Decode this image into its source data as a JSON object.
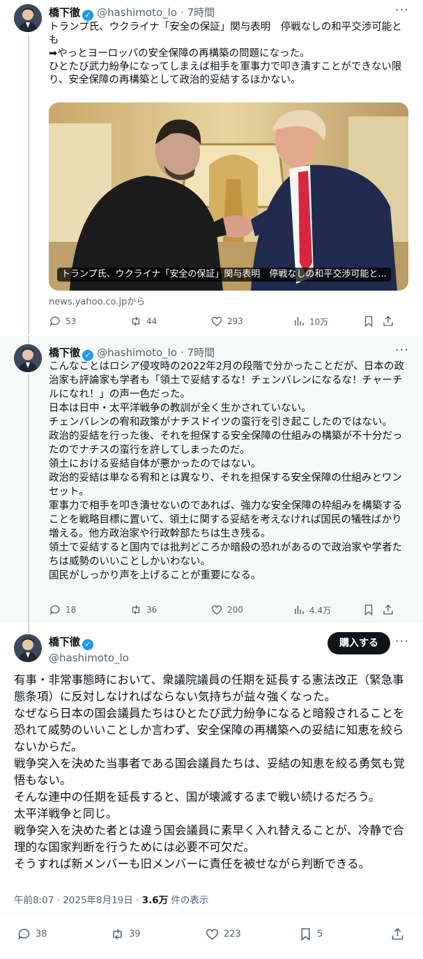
{
  "tweet1": {
    "name": "橋下徹",
    "handle": "@hashimoto_lo",
    "time": "· 7時間",
    "text": "トランプ氏、ウクライナ「安全の保証」関与表明　停戦なしの和平交渉可能とも\n➡やっとヨーロッパの安全保障の再構築の問題になった。\nひとたび武力紛争になってしまえば相手を軍事力で叩き潰すことができない限り、安全保障の再構築として政治的妥結するほかない。",
    "card_caption": "トランプ氏、ウクライナ「安全の保証」関与表明　停戦なしの和平交渉可能と...",
    "card_source": "news.yahoo.co.jpから",
    "replies": "53",
    "retweets": "44",
    "likes": "293",
    "views": "10万"
  },
  "tweet2": {
    "name": "橋下徹",
    "handle": "@hashimoto_lo",
    "time": "· 7時間",
    "text": "こんなことはロシア侵攻時の2022年2月の段階で分かったことだが、日本の政治家も評論家も学者も「領土で妥結するな！チェンバレンになるな！チャーチルになれ！」の声一色だった。\n日本は日中・太平洋戦争の教訓が全く生かされていない。\nチェンバレンの宥和政策がナチスドイツの蛮行を引き起こしたのではない。\n政治的妥結を行った後、それを担保する安全保障の仕組みの構築が不十分だったのでナチスの蛮行を許してしまったのだ。\n領土における妥結自体が悪かったのではない。\n政治的妥結は単なる宥和とは異なり、それを担保する安全保障の仕組みとワンセット。\n軍事力で相手を叩き潰せないのであれば、強力な安全保障の枠組みを構築することを戦略目標に置いて、領土に関する妥結を考えなければ国民の犠牲ばかり増える。他方政治家や行政幹部たちは生き残る。\n領土で妥結すると国内では批判どころか暗殺の恐れがあるので政治家や学者たちは威勢のいいことしかいわない。\n国民がしっかり声を上げることが重要になる。",
    "replies": "18",
    "retweets": "36",
    "likes": "200",
    "views": "4.4万"
  },
  "tweet3": {
    "name": "橋下徹",
    "handle": "@hashimoto_lo",
    "subscribe": "購入する",
    "text": "有事・非常事態時において、衆議院議員の任期を延長する憲法改正（緊急事態条項）に反対しなければならない気持ちが益々強くなった。\nなぜなら日本の国会議員たちはひとたび武力紛争になると暗殺されることを恐れて威勢のいいことしか言わず、安全保障の再構築への妥結に知恵を絞らないからだ。\n戦争突入を決めた当事者である国会議員たちは、妥結の知恵を絞る勇気も覚悟もない。\nそんな連中の任期を延長すると、国が壊滅するまで戦い続けるだろう。\n太平洋戦争と同じ。\n戦争突入を決めた者とは違う国会議員に素早く入れ替えることが、冷静で合理的な国家判断を行うためには必要不可欠だ。\nそうすれば新メンバーも旧メンバーに責任を被せながら判断できる。",
    "timestamp": "午前8:07 · 2025年8月19日 · ",
    "view_count": "3.6万",
    "view_label": " 件の表示",
    "replies": "38",
    "retweets": "39",
    "likes": "223",
    "bookmarks": "5"
  }
}
